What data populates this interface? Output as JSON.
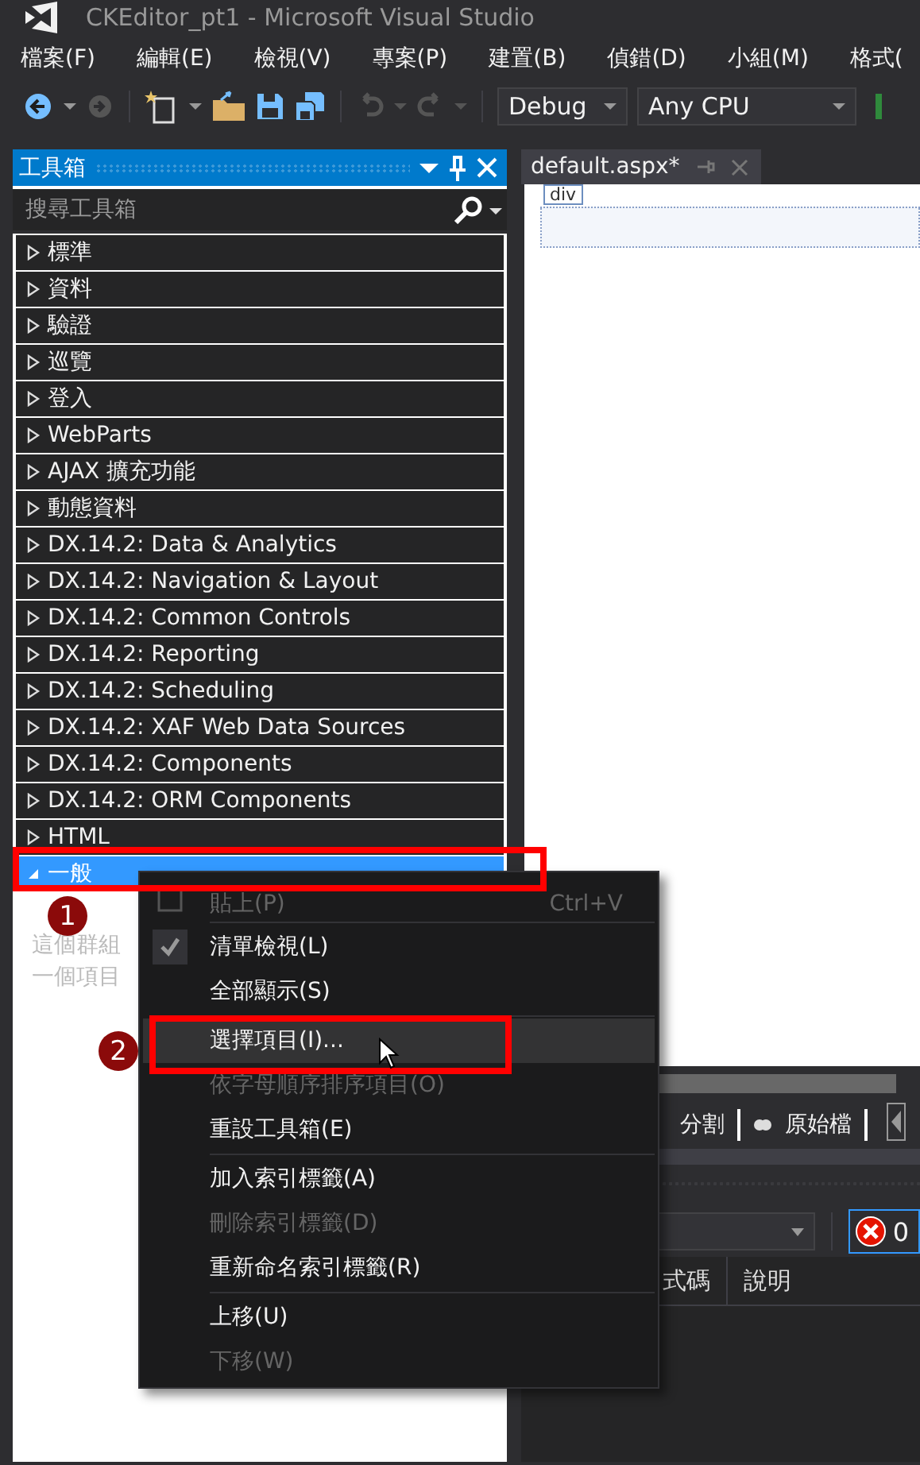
{
  "window": {
    "title": "CKEditor_pt1 - Microsoft Visual Studio"
  },
  "menu_bar": [
    "檔案(F)",
    "編輯(E)",
    "檢視(V)",
    "專案(P)",
    "建置(B)",
    "偵錯(D)",
    "小組(M)",
    "格式("
  ],
  "toolbar": {
    "configuration": "Debug",
    "platform": "Any CPU"
  },
  "toolbox": {
    "title": "工具箱",
    "search": {
      "placeholder": "搜尋工具箱"
    },
    "groups": [
      {
        "label": "標準",
        "expanded": false,
        "selected": false
      },
      {
        "label": "資料",
        "expanded": false,
        "selected": false
      },
      {
        "label": "驗證",
        "expanded": false,
        "selected": false
      },
      {
        "label": "巡覽",
        "expanded": false,
        "selected": false
      },
      {
        "label": "登入",
        "expanded": false,
        "selected": false
      },
      {
        "label": "WebParts",
        "expanded": false,
        "selected": false
      },
      {
        "label": "AJAX 擴充功能",
        "expanded": false,
        "selected": false
      },
      {
        "label": "動態資料",
        "expanded": false,
        "selected": false
      },
      {
        "label": "DX.14.2: Data & Analytics",
        "expanded": false,
        "selected": false
      },
      {
        "label": "DX.14.2: Navigation & Layout",
        "expanded": false,
        "selected": false
      },
      {
        "label": "DX.14.2: Common Controls",
        "expanded": false,
        "selected": false
      },
      {
        "label": "DX.14.2: Reporting",
        "expanded": false,
        "selected": false
      },
      {
        "label": "DX.14.2: Scheduling",
        "expanded": false,
        "selected": false
      },
      {
        "label": "DX.14.2: XAF Web Data Sources",
        "expanded": false,
        "selected": false
      },
      {
        "label": "DX.14.2: Components",
        "expanded": false,
        "selected": false
      },
      {
        "label": "DX.14.2: ORM Components",
        "expanded": false,
        "selected": false
      },
      {
        "label": "HTML",
        "expanded": false,
        "selected": false
      },
      {
        "label": "一般",
        "expanded": true,
        "selected": true
      }
    ],
    "empty_text": [
      "這個群組",
      "一個項目"
    ]
  },
  "editor": {
    "tab": {
      "label": "default.aspx*"
    },
    "element_tag": "div",
    "view_tabs": [
      "分割",
      "原始檔"
    ],
    "error_count": "0",
    "columns": [
      "式碼",
      "說明"
    ]
  },
  "context_menu": {
    "items": [
      {
        "kind": "item",
        "label": "貼上(P)",
        "shortcut": "Ctrl+V",
        "icon": true,
        "disabled": true,
        "checked": false,
        "selected": false
      },
      {
        "kind": "separator"
      },
      {
        "kind": "item",
        "label": "清單檢視(L)",
        "disabled": false,
        "checked": true,
        "selected": false
      },
      {
        "kind": "item",
        "label": "全部顯示(S)",
        "disabled": false,
        "checked": false,
        "selected": false
      },
      {
        "kind": "separator"
      },
      {
        "kind": "item",
        "label": "選擇項目(I)...",
        "disabled": false,
        "checked": false,
        "selected": true
      },
      {
        "kind": "item",
        "label": "依字母順序排序項目(O)",
        "disabled": true,
        "checked": false,
        "selected": false
      },
      {
        "kind": "item",
        "label": "重設工具箱(E)",
        "disabled": false,
        "checked": false,
        "selected": false
      },
      {
        "kind": "separator"
      },
      {
        "kind": "item",
        "label": "加入索引標籤(A)",
        "disabled": false,
        "checked": false,
        "selected": false
      },
      {
        "kind": "item",
        "label": "刪除索引標籤(D)",
        "disabled": true,
        "checked": false,
        "selected": false
      },
      {
        "kind": "item",
        "label": "重新命名索引標籤(R)",
        "disabled": false,
        "checked": false,
        "selected": false
      },
      {
        "kind": "separator"
      },
      {
        "kind": "item",
        "label": "上移(U)",
        "disabled": false,
        "checked": false,
        "selected": false
      },
      {
        "kind": "item",
        "label": "下移(W)",
        "disabled": true,
        "checked": false,
        "selected": false
      }
    ]
  },
  "annotations": [
    {
      "number": "1"
    },
    {
      "number": "2"
    }
  ]
}
